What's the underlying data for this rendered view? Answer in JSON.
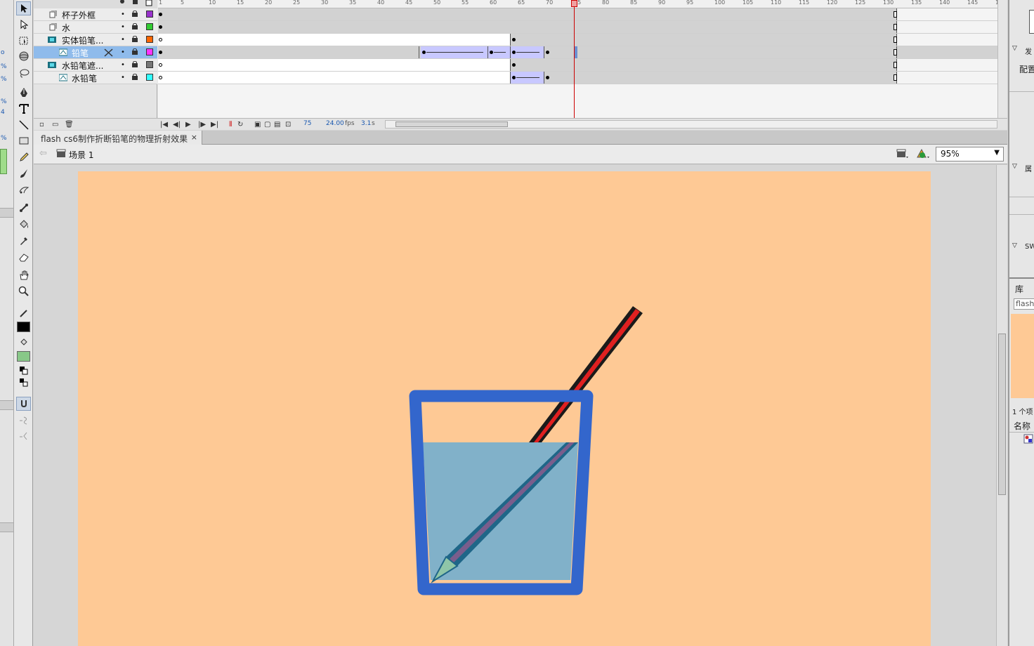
{
  "timeline": {
    "ruler_ticks": [
      "1",
      "5",
      "10",
      "15",
      "20",
      "25",
      "30",
      "35",
      "40",
      "45",
      "50",
      "55",
      "60",
      "65",
      "70",
      "75",
      "80",
      "85",
      "90",
      "95",
      "100",
      "105",
      "110",
      "115",
      "120",
      "125",
      "130",
      "135",
      "140",
      "145",
      "1"
    ],
    "layers": [
      {
        "name": "杯子外框",
        "color": "#9933cc"
      },
      {
        "name": "水",
        "color": "#33cc33"
      },
      {
        "name": "实体铅笔...",
        "color": "#ff6600"
      },
      {
        "name": "铅笔",
        "color": "#ff33ff"
      },
      {
        "name": "水铅笔遮...",
        "color": "#777777"
      },
      {
        "name": "水铅笔",
        "color": "#33ffff"
      }
    ],
    "current_frame": "75",
    "fps": "24.00",
    "fps_unit": "fps",
    "elapsed": "3.1",
    "elapsed_unit": "s"
  },
  "document": {
    "tab_title": "flash cs6制作折断铅笔的物理折射效果",
    "close_glyph": "×",
    "scene": "场景 1",
    "zoom": "95%"
  },
  "right_panel": {
    "publish_label": "发",
    "profile_label": "配置",
    "properties_label": "属",
    "swatches_label": "SW",
    "library_label": "库",
    "library_select": "flash",
    "items_count": "1 个项",
    "name_column": "名称"
  },
  "left_sliver": {
    "ticks": [
      "o",
      "%",
      "%",
      "%",
      "4",
      "%"
    ]
  },
  "colors": {
    "stage": "#fec995",
    "cup": "#3366cc",
    "water": "#81b1c9",
    "pencil_outside": "#e02020",
    "pencil_inside": "#7a5d8c",
    "tween": "#c8c8ff",
    "playhead": "#cc0000"
  }
}
